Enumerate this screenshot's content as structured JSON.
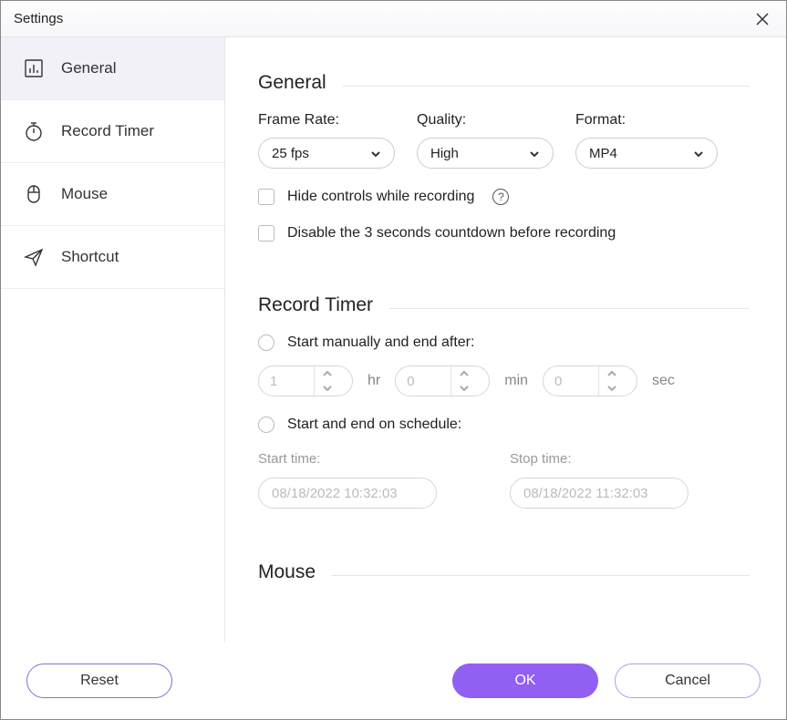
{
  "window": {
    "title": "Settings"
  },
  "sidebar": {
    "items": [
      {
        "label": "General"
      },
      {
        "label": "Record Timer"
      },
      {
        "label": "Mouse"
      },
      {
        "label": "Shortcut"
      }
    ]
  },
  "general": {
    "heading": "General",
    "frame_rate_label": "Frame Rate:",
    "frame_rate_value": "25 fps",
    "quality_label": "Quality:",
    "quality_value": "High",
    "format_label": "Format:",
    "format_value": "MP4",
    "hide_controls_label": "Hide controls while recording",
    "disable_countdown_label": "Disable the 3 seconds countdown before recording"
  },
  "timer": {
    "heading": "Record Timer",
    "start_manual_label": "Start manually and end after:",
    "hr_value": "1",
    "hr_unit": "hr",
    "min_value": "0",
    "min_unit": "min",
    "sec_value": "0",
    "sec_unit": "sec",
    "schedule_label": "Start and end on schedule:",
    "start_time_label": "Start time:",
    "start_time_value": "08/18/2022 10:32:03",
    "stop_time_label": "Stop time:",
    "stop_time_value": "08/18/2022 11:32:03"
  },
  "mouse": {
    "heading": "Mouse"
  },
  "footer": {
    "reset_label": "Reset",
    "ok_label": "OK",
    "cancel_label": "Cancel"
  }
}
